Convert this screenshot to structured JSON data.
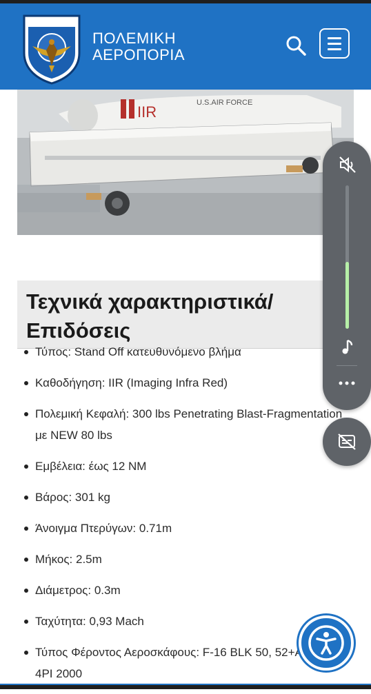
{
  "header": {
    "brand_line1": "ΠΟΛΕΜΙΚΗ",
    "brand_line2": "ΑΕΡΟΠΟΡΙΑ",
    "logo_motto": "ΑΙΕΝ ΥΠΕΙΡΑΤΕΙΝ",
    "logo_icon": "hellenic-air-force-crest",
    "search_icon": "search-icon",
    "menu_icon": "hamburger-menu-icon",
    "background_color": "#1f72c4"
  },
  "hero": {
    "missile_marking": "IIR",
    "missile_text": "U.S.AIR FORCE"
  },
  "section": {
    "title": "Τεχνικά χαρακτηριστικά/ Επιδόσεις"
  },
  "specs": [
    "Τύπος: Stand Off κατευθυνόμενο βλήμα",
    "Καθοδήγηση: IIR (Imaging Infra Red)",
    "Πολεμική Κεφαλή: 300 lbs Penetrating Blast-Fragmentation με NEW 80 lbs",
    "Εμβέλεια: έως 12 NM",
    "Βάρος: 301 kg",
    "Άνοιγμα Πτερύγων: 0.71m",
    "Μήκος: 2.5m",
    "Διάμετρος: 0.3m",
    "Ταχύτητα: 0,93 Mach",
    "Τύπος Φέροντος Αεροσκάφους: F-16 BLK 50, 52+ADV / F-4PI 2000"
  ],
  "volume_panel": {
    "level": 0.47,
    "icons": [
      "mute-icon",
      "music-note-icon",
      "more-options-icon"
    ],
    "fill_color": "#b7f0a8"
  },
  "caption_button": {
    "icon": "live-caption-off-icon"
  },
  "accessibility_button": {
    "icon": "accessibility-icon"
  }
}
